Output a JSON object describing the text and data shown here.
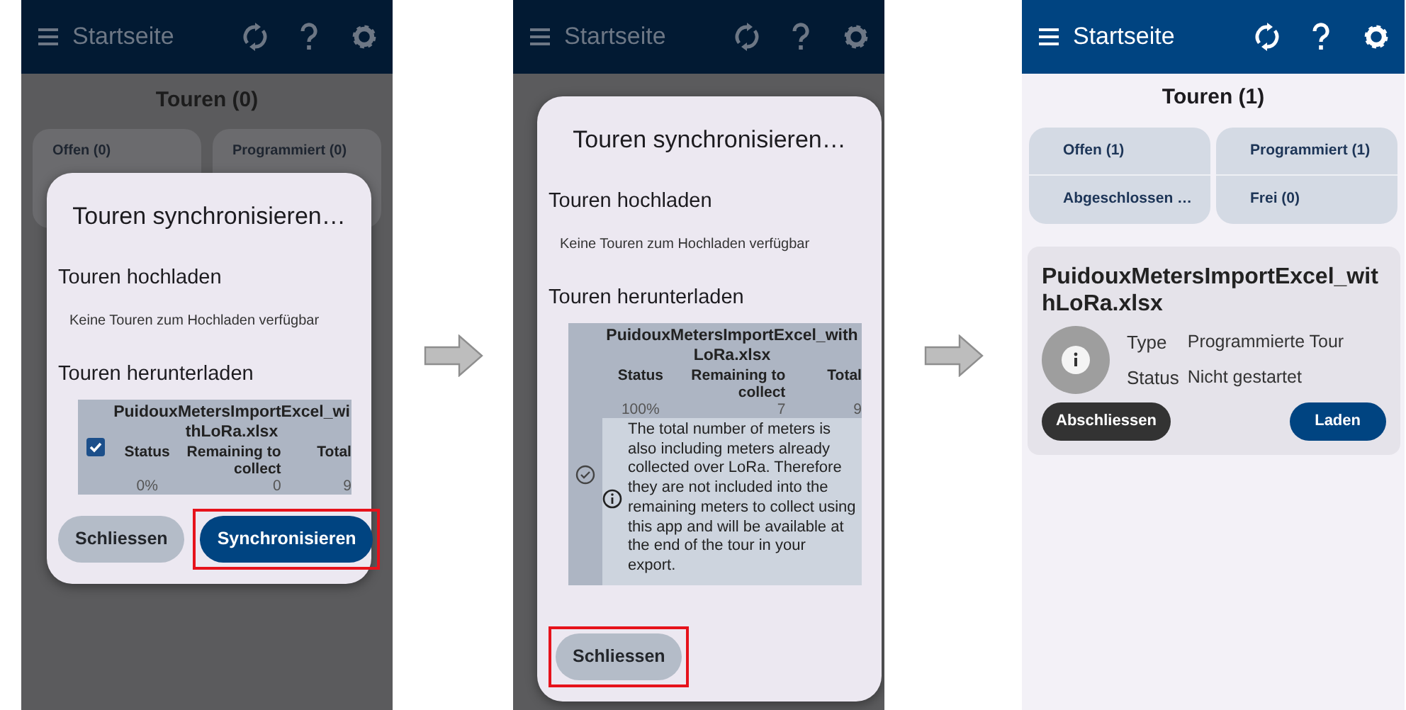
{
  "screens": [
    {
      "dimmed": true,
      "header": {
        "title": "Startseite"
      },
      "background": {
        "heading": "Touren (0)",
        "tiles": [
          "Offen (0)",
          "Programmiert (0)"
        ]
      },
      "dialog": {
        "title": "Touren synchronisieren…",
        "upload_heading": "Touren hochladen",
        "upload_text": "Keine Touren zum Hochladen verfügbar",
        "download_heading": "Touren herunterladen",
        "tour": {
          "kind": "checkbox",
          "checked": true,
          "name": "PuidouxMetersImportExcel_withLoRa.xlsx",
          "columns": [
            "Status",
            "Remaining to collect",
            "Total"
          ],
          "values": [
            "0%",
            "0",
            "9"
          ]
        },
        "buttons": [
          {
            "label": "Schliessen",
            "kind": "secondary",
            "highlighted": false
          },
          {
            "label": "Synchronisieren",
            "kind": "primary",
            "highlighted": true
          }
        ]
      }
    },
    {
      "dimmed": true,
      "header": {
        "title": "Startseite"
      },
      "dialog": {
        "title": "Touren synchronisieren…",
        "upload_heading": "Touren hochladen",
        "upload_text": "Keine Touren zum Hochladen verfügbar",
        "download_heading": "Touren herunterladen",
        "tour": {
          "kind": "done",
          "name": "PuidouxMetersImportExcel_withLoRa.xlsx",
          "columns": [
            "Status",
            "Remaining to collect",
            "Total"
          ],
          "values": [
            "100%",
            "7",
            "9"
          ],
          "note": "The total number of meters is also including meters already collected over LoRa. Therefore they are not included into the remaining meters to collect using this app and will be available at the end of the tour in your export."
        },
        "buttons": [
          {
            "label": "Schliessen",
            "kind": "secondary",
            "highlighted": true
          }
        ]
      }
    },
    {
      "dimmed": false,
      "header": {
        "title": "Startseite"
      },
      "content": {
        "heading": "Touren (1)",
        "tile_groups": [
          [
            "Offen (1)",
            "Abgeschlossen …"
          ],
          [
            "Programmiert (1)",
            "Frei (0)"
          ]
        ],
        "tour_card": {
          "title": "PuidouxMetersImportExcel_withLoRa.xlsx",
          "fields": [
            {
              "label": "Type",
              "value": "Programmierte Tour"
            },
            {
              "label": "Status",
              "value": "Nicht gestartet"
            }
          ],
          "buttons": [
            {
              "label": "Abschliessen",
              "kind": "dark"
            },
            {
              "label": "Laden",
              "kind": "primary"
            }
          ]
        }
      }
    }
  ]
}
